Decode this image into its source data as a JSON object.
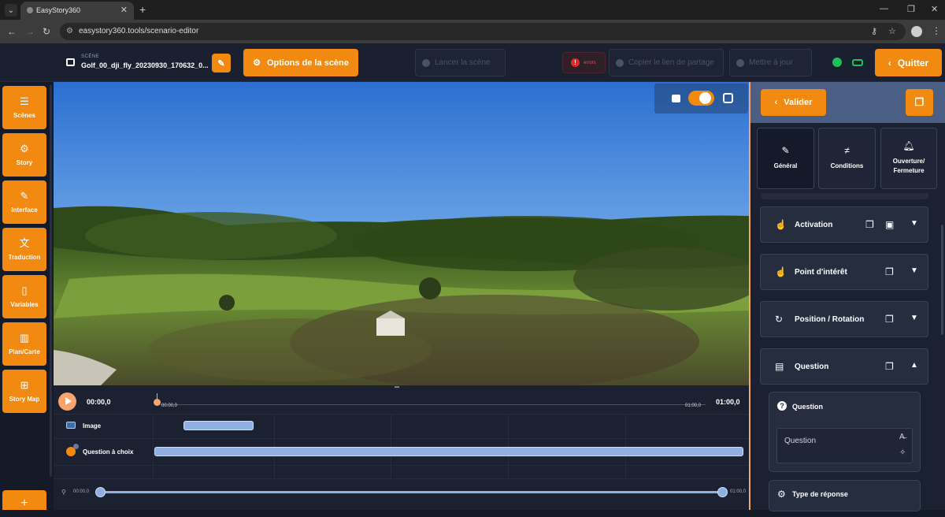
{
  "browser": {
    "tab_title": "EasyStory360",
    "url": "easystory360.tools/scenario-editor"
  },
  "header": {
    "scene_caption": "SCÈNE",
    "scene_name": "Golf_00_dji_fly_20230930_170632_0...",
    "options_label": "Options de la scène",
    "launch_label": "Lancer la scène",
    "errors_label": "errors",
    "share_label": "Copier le lien de partage",
    "update_label": "Mettre à jour",
    "quit_label": "Quitter"
  },
  "sidebar": {
    "items": [
      {
        "label": "Scènes",
        "icon": "menu-icon"
      },
      {
        "label": "Story",
        "icon": "gear-icon"
      },
      {
        "label": "Interface",
        "icon": "brush-icon"
      },
      {
        "label": "Traduction",
        "icon": "translate-icon"
      },
      {
        "label": "Variables",
        "icon": "bookmark-icon"
      },
      {
        "label": "Plan/Carte",
        "icon": "map-icon"
      },
      {
        "label": "Story Map",
        "icon": "story-map-icon"
      }
    ],
    "add_label": "+"
  },
  "timeline": {
    "current_time": "00:00,0",
    "end_time": "01:00,0",
    "scrub_start": "00:00,0",
    "scrub_end": "01:00,0",
    "zoom_start": "00:00,0",
    "zoom_end": "01:00,0",
    "tracks": [
      {
        "label": "Image"
      },
      {
        "label": "Question à choix"
      }
    ]
  },
  "panel": {
    "validate_label": "Valider",
    "tabs": [
      {
        "label": "Général",
        "icon": "pencil-icon"
      },
      {
        "label": "Conditions",
        "icon": "conditions-icon"
      },
      {
        "label": "Ouverture/ Fermeture",
        "icon": "bell-icon"
      }
    ],
    "sections": [
      {
        "label": "Activation"
      },
      {
        "label": "Point d'intérêt"
      },
      {
        "label": "Position / Rotation"
      },
      {
        "label": "Question"
      }
    ],
    "question_card_title": "Question",
    "question_input_value": "Question",
    "answer_type_label": "Type de réponse"
  },
  "colors": {
    "accent": "#f28a12",
    "background": "#151a28",
    "success": "#1fbf5a",
    "error": "#e02a2a"
  }
}
